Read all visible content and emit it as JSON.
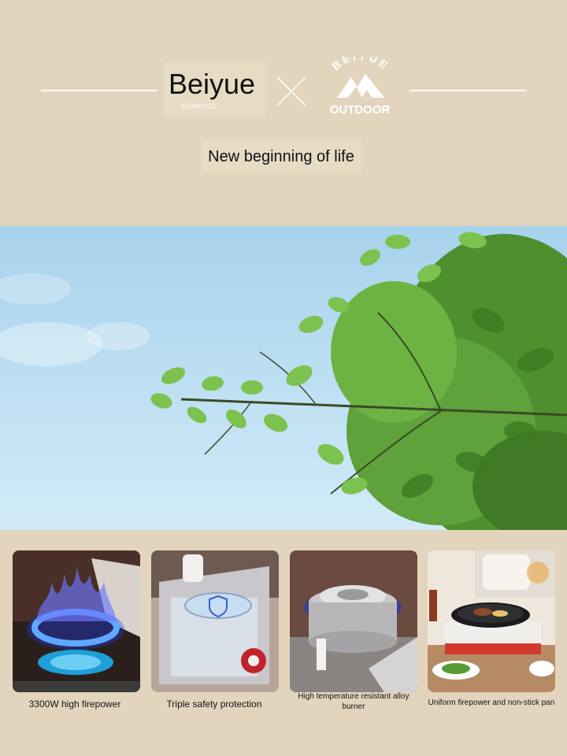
{
  "header": {
    "brand_name": "Beiyue",
    "brand_sub": "KAMPING",
    "logo_arc": "BEIYUE",
    "logo_word": "OUTDOOR",
    "tagline": "New beginning of life",
    "cross_icon": "cross-icon"
  },
  "hero": {
    "image": "tree-branch-against-sky"
  },
  "features": [
    {
      "caption": "3300W high firepower",
      "image": "blue-flame-burner"
    },
    {
      "caption": "Triple safety protection",
      "image": "stove-safety-shield"
    },
    {
      "caption": "High temperature resistant alloy burner",
      "image": "alloy-burner-closeup"
    },
    {
      "caption": "Uniform firepower and non-stick pan",
      "image": "grill-pan-food"
    }
  ]
}
